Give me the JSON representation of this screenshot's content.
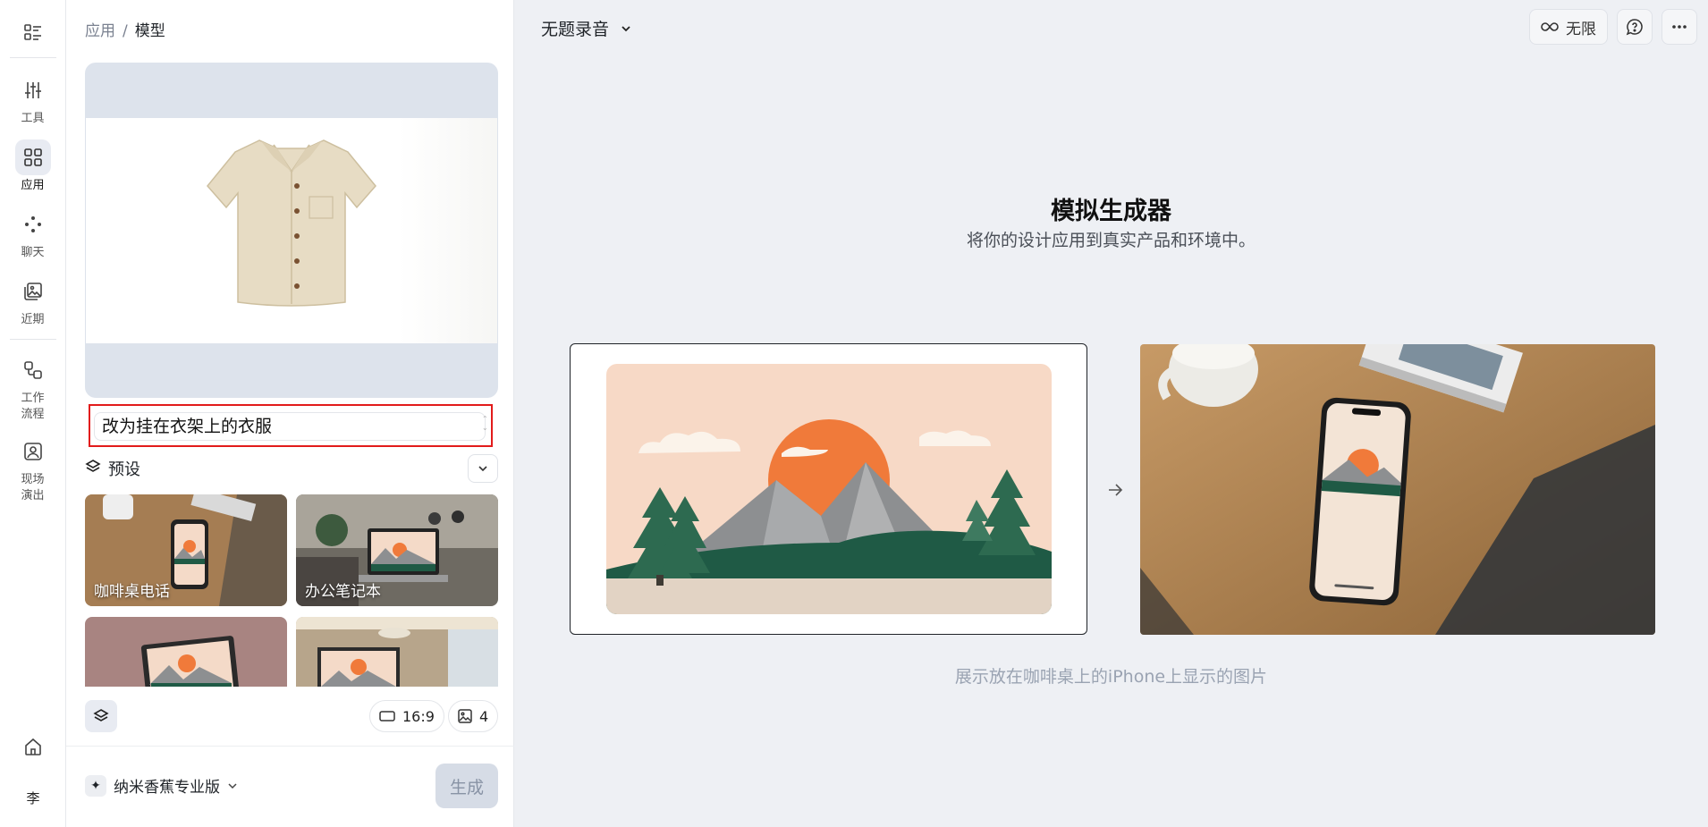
{
  "rail": {
    "items": [
      {
        "label": "工具",
        "icon": "sliders-icon"
      },
      {
        "label": "应用",
        "icon": "apps-grid-icon",
        "active": true
      },
      {
        "label": "聊天",
        "icon": "chat-dots-icon"
      },
      {
        "label": "近期",
        "icon": "gallery-icon"
      },
      {
        "label": "工作\n流程",
        "icon": "workflow-icon"
      },
      {
        "label": "现场\n演出",
        "icon": "live-icon"
      }
    ],
    "avatar": "李"
  },
  "breadcrumb": {
    "parent": "应用",
    "current": "模型"
  },
  "prompt": {
    "value": "改为挂在衣架上的衣服"
  },
  "presets": {
    "label": "预设",
    "cards": [
      {
        "caption": "咖啡桌电话"
      },
      {
        "caption": "办公笔记本"
      },
      {
        "caption": ""
      },
      {
        "caption": ""
      }
    ]
  },
  "options": {
    "aspect_ratio": "16:9",
    "image_count": "4"
  },
  "model": {
    "name": "纳米香蕉专业版"
  },
  "generate_label": "生成",
  "header": {
    "title": "无题录音",
    "unlimited_label": "无限"
  },
  "hero": {
    "title": "模拟生成器",
    "subtitle": "将你的设计应用到真实产品和环境中。",
    "caption": "展示放在咖啡桌上的iPhone上显示的图片"
  },
  "colors": {
    "accent_red": "#e21b1b",
    "sun_orange": "#f07a3a",
    "forest_green": "#1f5a45"
  }
}
